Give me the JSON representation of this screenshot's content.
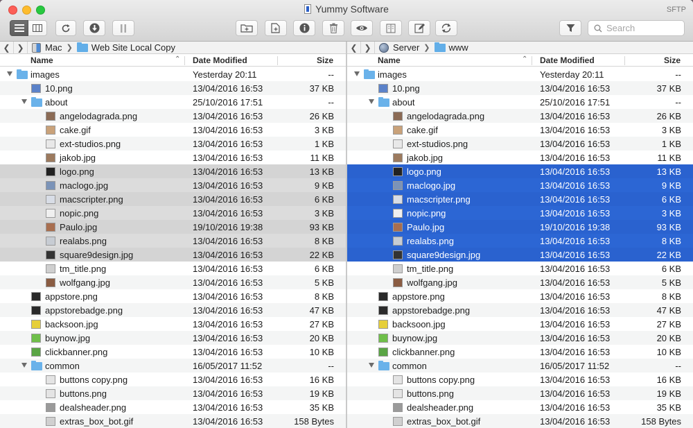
{
  "window": {
    "title": "Yummy Software",
    "protocol": "SFTP"
  },
  "toolbar": {
    "search_placeholder": "Search",
    "buttons": [
      {
        "id": "list-view",
        "icon": "list-view-icon"
      },
      {
        "id": "column-view",
        "icon": "column-view-icon"
      },
      {
        "id": "refresh",
        "icon": "refresh-icon"
      },
      {
        "id": "download",
        "icon": "download-icon"
      },
      {
        "id": "pause",
        "icon": "pause-icon"
      },
      {
        "id": "new-folder",
        "icon": "new-folder-icon"
      },
      {
        "id": "new-file",
        "icon": "new-file-icon"
      },
      {
        "id": "info",
        "icon": "info-icon"
      },
      {
        "id": "trash",
        "icon": "trash-icon"
      },
      {
        "id": "preview",
        "icon": "eye-icon"
      },
      {
        "id": "compare",
        "icon": "compare-icon"
      },
      {
        "id": "edit",
        "icon": "edit-icon"
      },
      {
        "id": "sync",
        "icon": "sync-icon"
      },
      {
        "id": "filter",
        "icon": "filter-icon"
      }
    ]
  },
  "columns": {
    "name": "Name",
    "date": "Date Modified",
    "size": "Size"
  },
  "left": {
    "path": [
      "Mac",
      "Web Site Local Copy"
    ],
    "rows": [
      {
        "name": "images",
        "date": "Yesterday 20:11",
        "size": "--",
        "level": 0,
        "folder": true,
        "open": true,
        "icon": "#6ab2ea",
        "state": "none"
      },
      {
        "name": "10.png",
        "date": "13/04/2016 16:53",
        "size": "37 KB",
        "level": 1,
        "icon": "#5b82c9",
        "state": "none"
      },
      {
        "name": "about",
        "date": "25/10/2016 17:51",
        "size": "--",
        "level": 1,
        "folder": true,
        "open": true,
        "icon": "#6ab2ea",
        "state": "none"
      },
      {
        "name": "angelodagrada.png",
        "date": "13/04/2016 16:53",
        "size": "26 KB",
        "level": 2,
        "icon": "#8b6b55",
        "state": "none"
      },
      {
        "name": "cake.gif",
        "date": "13/04/2016 16:53",
        "size": "3 KB",
        "level": 2,
        "icon": "#c9a27a",
        "state": "none"
      },
      {
        "name": "ext-studios.png",
        "date": "13/04/2016 16:53",
        "size": "1 KB",
        "level": 2,
        "icon": "#e8e8e8",
        "state": "none"
      },
      {
        "name": "jakob.jpg",
        "date": "13/04/2016 16:53",
        "size": "11 KB",
        "level": 2,
        "icon": "#9c7a5e",
        "state": "none"
      },
      {
        "name": "logo.png",
        "date": "13/04/2016 16:53",
        "size": "13 KB",
        "level": 2,
        "icon": "#222222",
        "state": "gray"
      },
      {
        "name": "maclogo.jpg",
        "date": "13/04/2016 16:53",
        "size": "9 KB",
        "level": 2,
        "icon": "#7b93b8",
        "state": "gray"
      },
      {
        "name": "macscripter.png",
        "date": "13/04/2016 16:53",
        "size": "6 KB",
        "level": 2,
        "icon": "#d8dde6",
        "state": "gray"
      },
      {
        "name": "nopic.png",
        "date": "13/04/2016 16:53",
        "size": "3 KB",
        "level": 2,
        "icon": "#f0f0f0",
        "state": "gray"
      },
      {
        "name": "Paulo.jpg",
        "date": "19/10/2016 19:38",
        "size": "93 KB",
        "level": 2,
        "icon": "#a86e4f",
        "state": "gray"
      },
      {
        "name": "realabs.png",
        "date": "13/04/2016 16:53",
        "size": "8 KB",
        "level": 2,
        "icon": "#c7ccd3",
        "state": "gray"
      },
      {
        "name": "square9design.jpg",
        "date": "13/04/2016 16:53",
        "size": "22 KB",
        "level": 2,
        "icon": "#333333",
        "state": "gray"
      },
      {
        "name": "tm_title.png",
        "date": "13/04/2016 16:53",
        "size": "6 KB",
        "level": 2,
        "icon": "#cfcfcf",
        "state": "none"
      },
      {
        "name": "wolfgang.jpg",
        "date": "13/04/2016 16:53",
        "size": "5 KB",
        "level": 2,
        "icon": "#8a5c42",
        "state": "none"
      },
      {
        "name": "appstore.png",
        "date": "13/04/2016 16:53",
        "size": "8 KB",
        "level": 1,
        "icon": "#2a2a2a",
        "state": "none"
      },
      {
        "name": "appstorebadge.png",
        "date": "13/04/2016 16:53",
        "size": "47 KB",
        "level": 1,
        "icon": "#2a2a2a",
        "state": "none"
      },
      {
        "name": "backsoon.jpg",
        "date": "13/04/2016 16:53",
        "size": "27 KB",
        "level": 1,
        "icon": "#e6cf3a",
        "state": "none"
      },
      {
        "name": "buynow.jpg",
        "date": "13/04/2016 16:53",
        "size": "20 KB",
        "level": 1,
        "icon": "#6fbf4a",
        "state": "none"
      },
      {
        "name": "clickbanner.png",
        "date": "13/04/2016 16:53",
        "size": "10 KB",
        "level": 1,
        "icon": "#5aa545",
        "state": "none"
      },
      {
        "name": "common",
        "date": "16/05/2017 11:52",
        "size": "--",
        "level": 1,
        "folder": true,
        "open": true,
        "icon": "#6ab2ea",
        "state": "none"
      },
      {
        "name": "buttons copy.png",
        "date": "13/04/2016 16:53",
        "size": "16 KB",
        "level": 2,
        "icon": "#e4e4e4",
        "state": "none"
      },
      {
        "name": "buttons.png",
        "date": "13/04/2016 16:53",
        "size": "19 KB",
        "level": 2,
        "icon": "#e4e4e4",
        "state": "none"
      },
      {
        "name": "dealsheader.png",
        "date": "13/04/2016 16:53",
        "size": "35 KB",
        "level": 2,
        "icon": "#9a9a9a",
        "state": "none"
      },
      {
        "name": "extras_box_bot.gif",
        "date": "13/04/2016 16:53",
        "size": "158 Bytes",
        "level": 2,
        "icon": "#d0d0d0",
        "state": "none"
      }
    ]
  },
  "right": {
    "path": [
      "Server",
      "www"
    ],
    "rows": [
      {
        "name": "images",
        "date": "Yesterday 20:11",
        "size": "--",
        "level": 0,
        "folder": true,
        "open": true,
        "icon": "#6ab2ea",
        "state": "none"
      },
      {
        "name": "10.png",
        "date": "13/04/2016 16:53",
        "size": "37 KB",
        "level": 1,
        "icon": "#5b82c9",
        "state": "none"
      },
      {
        "name": "about",
        "date": "25/10/2016 17:51",
        "size": "--",
        "level": 1,
        "folder": true,
        "open": true,
        "icon": "#6ab2ea",
        "state": "none"
      },
      {
        "name": "angelodagrada.png",
        "date": "13/04/2016 16:53",
        "size": "26 KB",
        "level": 2,
        "icon": "#8b6b55",
        "state": "none"
      },
      {
        "name": "cake.gif",
        "date": "13/04/2016 16:53",
        "size": "3 KB",
        "level": 2,
        "icon": "#c9a27a",
        "state": "none"
      },
      {
        "name": "ext-studios.png",
        "date": "13/04/2016 16:53",
        "size": "1 KB",
        "level": 2,
        "icon": "#e8e8e8",
        "state": "none"
      },
      {
        "name": "jakob.jpg",
        "date": "13/04/2016 16:53",
        "size": "11 KB",
        "level": 2,
        "icon": "#9c7a5e",
        "state": "none"
      },
      {
        "name": "logo.png",
        "date": "13/04/2016 16:53",
        "size": "13 KB",
        "level": 2,
        "icon": "#222222",
        "state": "sel"
      },
      {
        "name": "maclogo.jpg",
        "date": "13/04/2016 16:53",
        "size": "9 KB",
        "level": 2,
        "icon": "#7b93b8",
        "state": "sel"
      },
      {
        "name": "macscripter.png",
        "date": "13/04/2016 16:53",
        "size": "6 KB",
        "level": 2,
        "icon": "#d8dde6",
        "state": "sel"
      },
      {
        "name": "nopic.png",
        "date": "13/04/2016 16:53",
        "size": "3 KB",
        "level": 2,
        "icon": "#f0f0f0",
        "state": "sel"
      },
      {
        "name": "Paulo.jpg",
        "date": "19/10/2016 19:38",
        "size": "93 KB",
        "level": 2,
        "icon": "#a86e4f",
        "state": "sel"
      },
      {
        "name": "realabs.png",
        "date": "13/04/2016 16:53",
        "size": "8 KB",
        "level": 2,
        "icon": "#c7ccd3",
        "state": "sel"
      },
      {
        "name": "square9design.jpg",
        "date": "13/04/2016 16:53",
        "size": "22 KB",
        "level": 2,
        "icon": "#333333",
        "state": "sel"
      },
      {
        "name": "tm_title.png",
        "date": "13/04/2016 16:53",
        "size": "6 KB",
        "level": 2,
        "icon": "#cfcfcf",
        "state": "none"
      },
      {
        "name": "wolfgang.jpg",
        "date": "13/04/2016 16:53",
        "size": "5 KB",
        "level": 2,
        "icon": "#8a5c42",
        "state": "none"
      },
      {
        "name": "appstore.png",
        "date": "13/04/2016 16:53",
        "size": "8 KB",
        "level": 1,
        "icon": "#2a2a2a",
        "state": "none"
      },
      {
        "name": "appstorebadge.png",
        "date": "13/04/2016 16:53",
        "size": "47 KB",
        "level": 1,
        "icon": "#2a2a2a",
        "state": "none"
      },
      {
        "name": "backsoon.jpg",
        "date": "13/04/2016 16:53",
        "size": "27 KB",
        "level": 1,
        "icon": "#e6cf3a",
        "state": "none"
      },
      {
        "name": "buynow.jpg",
        "date": "13/04/2016 16:53",
        "size": "20 KB",
        "level": 1,
        "icon": "#6fbf4a",
        "state": "none"
      },
      {
        "name": "clickbanner.png",
        "date": "13/04/2016 16:53",
        "size": "10 KB",
        "level": 1,
        "icon": "#5aa545",
        "state": "none"
      },
      {
        "name": "common",
        "date": "16/05/2017 11:52",
        "size": "--",
        "level": 1,
        "folder": true,
        "open": true,
        "icon": "#6ab2ea",
        "state": "none"
      },
      {
        "name": "buttons copy.png",
        "date": "13/04/2016 16:53",
        "size": "16 KB",
        "level": 2,
        "icon": "#e4e4e4",
        "state": "none"
      },
      {
        "name": "buttons.png",
        "date": "13/04/2016 16:53",
        "size": "19 KB",
        "level": 2,
        "icon": "#e4e4e4",
        "state": "none"
      },
      {
        "name": "dealsheader.png",
        "date": "13/04/2016 16:53",
        "size": "35 KB",
        "level": 2,
        "icon": "#9a9a9a",
        "state": "none"
      },
      {
        "name": "extras_box_bot.gif",
        "date": "13/04/2016 16:53",
        "size": "158 Bytes",
        "level": 2,
        "icon": "#d0d0d0",
        "state": "none"
      }
    ]
  },
  "colors": {
    "selection": "#2c66d4",
    "inactive_selection": "#dcdcdc",
    "folder": "#6ab2ea"
  }
}
